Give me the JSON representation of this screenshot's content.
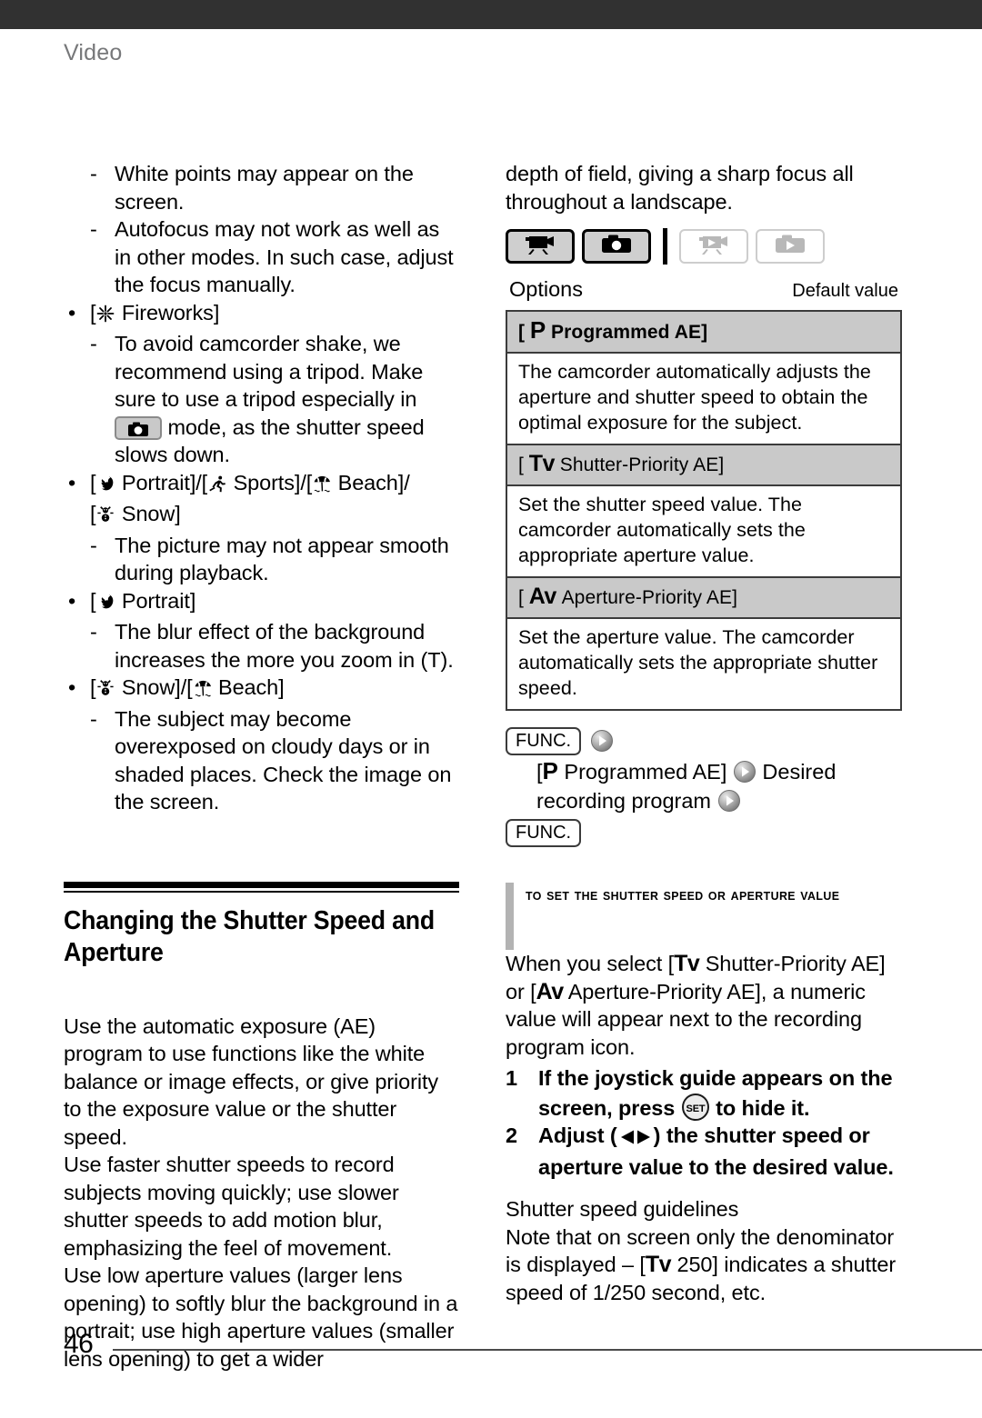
{
  "header": {
    "running_head": "Video"
  },
  "footer": {
    "page_number": "46"
  },
  "left_column": {
    "notes_continued": [
      {
        "type": "dash",
        "text": "White points may appear on the screen."
      },
      {
        "type": "dash",
        "text": "Autofocus may not work as well as in other modes. In such case, adjust the focus manually."
      }
    ],
    "fireworks_bullet": {
      "label": "Fireworks",
      "icon": "fireworks-icon",
      "note_before_chip": "To avoid camcorder shake, we recommend using a tripod. Make sure to use a tripod especially in",
      "chip_icon": "photo-camera-icon",
      "note_after_chip": "mode, as the shutter speed slows down."
    },
    "portrait_sports_beach_snow_bullet": {
      "items": [
        {
          "icon": "portrait-icon",
          "label": "Portrait"
        },
        {
          "icon": "sports-icon",
          "label": "Sports"
        },
        {
          "icon": "beach-icon",
          "label": "Beach"
        },
        {
          "icon": "snow-icon",
          "label": "Snow"
        }
      ],
      "note": "The picture may not appear smooth during playback."
    },
    "portrait_bullet": {
      "icon": "portrait-icon",
      "label": "Portrait",
      "note": "The blur effect of the background increases the more you zoom in (T)."
    },
    "snow_beach_bullet": {
      "items": [
        {
          "icon": "snow-icon",
          "label": "Snow"
        },
        {
          "icon": "beach-icon",
          "label": "Beach"
        }
      ],
      "note": "The subject may become overexposed on cloudy days or in shaded places. Check the image on the screen."
    },
    "section_heading": "Changing the Shutter Speed and Aperture",
    "paragraphs": [
      "Use the automatic exposure (AE) program to use functions like the white balance or image effects, or give priority to the exposure value or the shutter speed.",
      "Use faster shutter speeds to record subjects moving quickly; use slower shutter speeds to add motion blur, emphasizing the feel of movement.",
      "Use low aperture values (larger lens opening) to softly blur the background in a portrait; use high aperture values (smaller lens opening) to get a wider"
    ]
  },
  "right_column": {
    "continued_paragraph": "depth of field, giving a sharp focus all throughout a landscape.",
    "mode_bar": [
      {
        "name": "video-record-mode",
        "icon": "camcorder-record-icon",
        "state": "active"
      },
      {
        "name": "photo-record-mode",
        "icon": "photo-camera-icon",
        "state": "active"
      },
      {
        "name": "video-playback-mode",
        "icon": "camcorder-playback-icon",
        "state": "inactive"
      },
      {
        "name": "photo-playback-mode",
        "icon": "photo-playback-icon",
        "state": "inactive"
      }
    ],
    "options_label": "Options",
    "default_value_label": "Default value",
    "options_table": [
      {
        "icon": "P",
        "title": "Programmed AE",
        "is_default": true,
        "description": "The camcorder automatically adjusts the aperture and shutter speed to obtain the optimal exposure for the subject."
      },
      {
        "icon": "Tv",
        "title": "Shutter-Priority AE",
        "is_default": false,
        "description": "Set the shutter speed value. The camcorder automatically sets the appropriate aperture value."
      },
      {
        "icon": "Av",
        "title": "Aperture-Priority AE",
        "is_default": false,
        "description": "Set the aperture value. The camcorder automatically sets the appropriate shutter speed."
      }
    ],
    "func_path": {
      "func_key_label": "FUNC.",
      "step_icon": "P",
      "step_bracket_label": "Programmed AE",
      "step_desired": "Desired",
      "step_desired_cont": "recording program",
      "func_key_label_end": "FUNC."
    },
    "subsection_heading": "To set the shutter speed or aperture value",
    "subsection_paragraph_parts": {
      "a": "When you select [",
      "tv": "Tv",
      "b": "Shutter-Priority AE] or [",
      "av": "Av",
      "c": "Aperture-Priority AE], a numeric value will appear next to the recording program icon."
    },
    "steps": [
      {
        "number": "1",
        "text_before": "If the joystick guide appears on the screen, press",
        "button_icon": "set-button-icon",
        "button_label": "SET",
        "text_after": "to hide it."
      },
      {
        "number": "2",
        "text_before": "Adjust (",
        "joystick_icon": "left-right-arrows-icon",
        "text_after": ") the shutter speed or aperture value to the desired value."
      }
    ],
    "guidelines_title": "Shutter speed guidelines",
    "guidelines_parts": {
      "a": "Note that on screen only the denominator is displayed – [",
      "tv": "Tv",
      "b": "250] indicates a shutter speed of 1/250 second, etc."
    }
  },
  "colors": {
    "topbar": "#313131",
    "running_head": "#77787a",
    "table_header_bg": "#c9c9c9",
    "table_border": "#3b3b3b",
    "subhead_bar": "#b3b3b3",
    "mode_active_bg": "#cfcfcf",
    "mode_inactive_fg": "#b8b8b8"
  }
}
